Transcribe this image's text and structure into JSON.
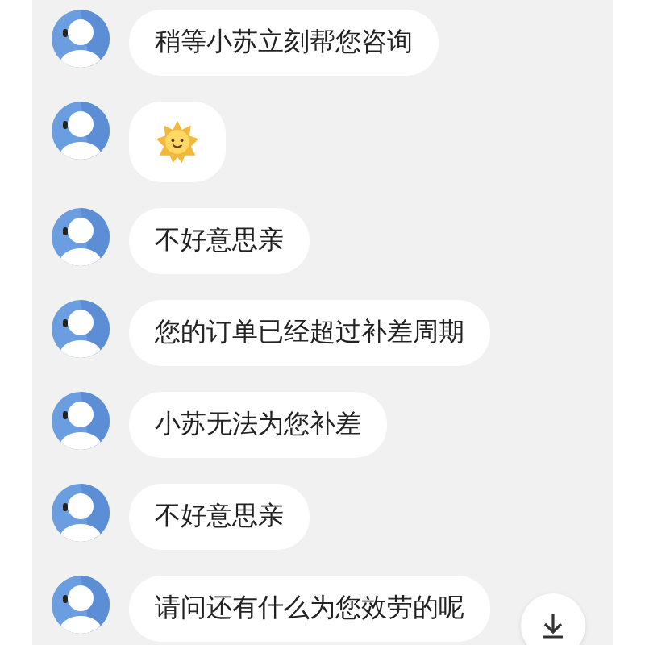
{
  "messages": [
    {
      "kind": "text",
      "text": "稍等小苏立刻帮您咨询"
    },
    {
      "kind": "sticker"
    },
    {
      "kind": "text",
      "text": "不好意思亲"
    },
    {
      "kind": "text",
      "text": "您的订单已经超过补差周期"
    },
    {
      "kind": "text",
      "text": "小苏无法为您补差"
    },
    {
      "kind": "text",
      "text": "不好意思亲"
    },
    {
      "kind": "text",
      "text": "请问还有什么为您效劳的呢"
    }
  ]
}
